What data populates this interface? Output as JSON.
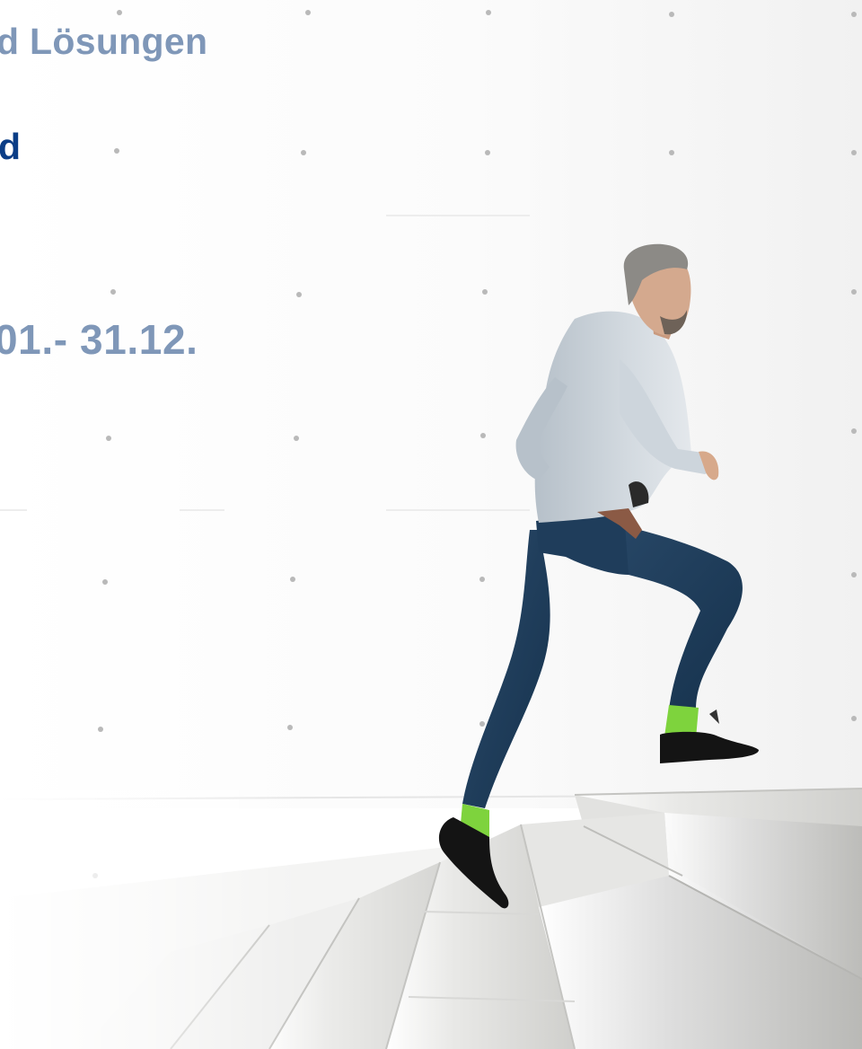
{
  "headline": {
    "line_1": "d Lösungen",
    "line_2": "d",
    "line_3": "01.- 31.12."
  },
  "colors": {
    "light_blue_text": "#7f97b8",
    "dark_blue_text": "#0b3d86",
    "sock_green": "#7ed33d",
    "jeans_navy": "#1e3b57",
    "shirt_grey": "#c9d1d8",
    "stone_grey": "#d4d4d2"
  },
  "photo": {
    "subject": "man-running-up-stairs",
    "background": "concrete-wall-with-tie-holes"
  }
}
